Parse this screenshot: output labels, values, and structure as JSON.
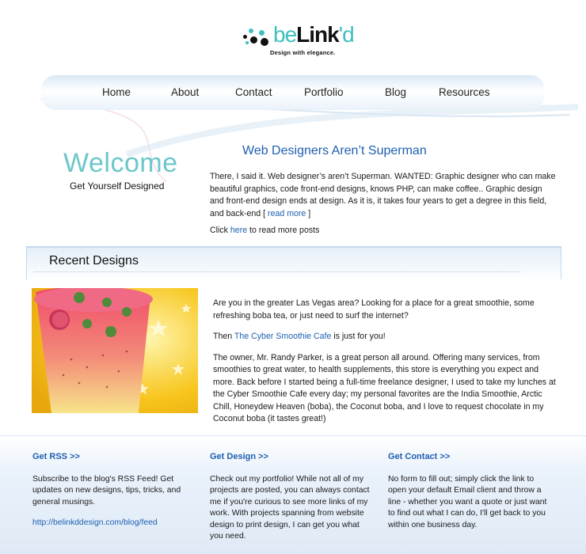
{
  "logo": {
    "be": "be",
    "link": "Link",
    "d": "'d",
    "tagline": "Design with elegance."
  },
  "nav": {
    "items": [
      "Home",
      "About",
      "Contact",
      "Portfolio",
      "Blog",
      "Resources"
    ]
  },
  "welcome": {
    "title": "Welcome",
    "subtitle": "Get Yourself Designed"
  },
  "post": {
    "title": "Web Designers Aren’t Superman",
    "body": "There, I said it. Web designer’s aren’t Superman. WANTED: Graphic designer who can make beautiful graphics, code front-end designs, knows PHP, can make coffee.. Graphic design and front-end design ends at design. As it is, it takes four years to get a degree in this field, and back-end",
    "read_more_open": "[ ",
    "read_more": "read more",
    "read_more_close": " ]",
    "more_prefix": "Click ",
    "more_link": "here",
    "more_suffix": " to read more posts"
  },
  "recent": {
    "title": "Recent Designs",
    "image_icon": "smoothie-photo",
    "p1": "Are you in the greater Las Vegas area? Looking for a place for a great smoothie, some refreshing boba tea, or just need to surf the internet?",
    "p2_prefix": "Then ",
    "p2_link": "The Cyber Smoothie Cafe",
    "p2_suffix": " is just for you!",
    "p3": "The owner, Mr. Randy Parker, is a great person all around. Offering many services, from smoothies to great water, to health supplements, this store is everything you expect and more. Back before I started being a full-time freelance designer, I used to take my lunches at the Cyber Smoothie Cafe every day; my personal favorites are the India Smoothie, Arctic Chill, Honeydew Heaven (boba), the Coconut boba, and I love to request chocolate in my Coconut boba (it tastes great!)"
  },
  "footer": {
    "rss": {
      "title": "Get RSS >>",
      "text": "Subscribe to the blog's RSS Feed! Get updates on new designs, tips, tricks, and general musings.",
      "link": "http://belinkddesign.com/blog/feed"
    },
    "design": {
      "title": "Get Design >>",
      "text": "Check out my portfolio! While not all of my projects are posted, you can always contact me if you're curious to see more links of my work. With projects spanning from website design to print design, I can get you what you need."
    },
    "contact": {
      "title": "Get Contact >>",
      "text": "No form to fill out; simply click the link to open your default Email client and throw a line - whether you want a quote or just want to find out what I can do, I'll get back to you within one business day."
    }
  },
  "colors": {
    "accent_teal": "#6cc7c9",
    "link_blue": "#1e5fb0",
    "nav_light": "#dbe8f5"
  }
}
